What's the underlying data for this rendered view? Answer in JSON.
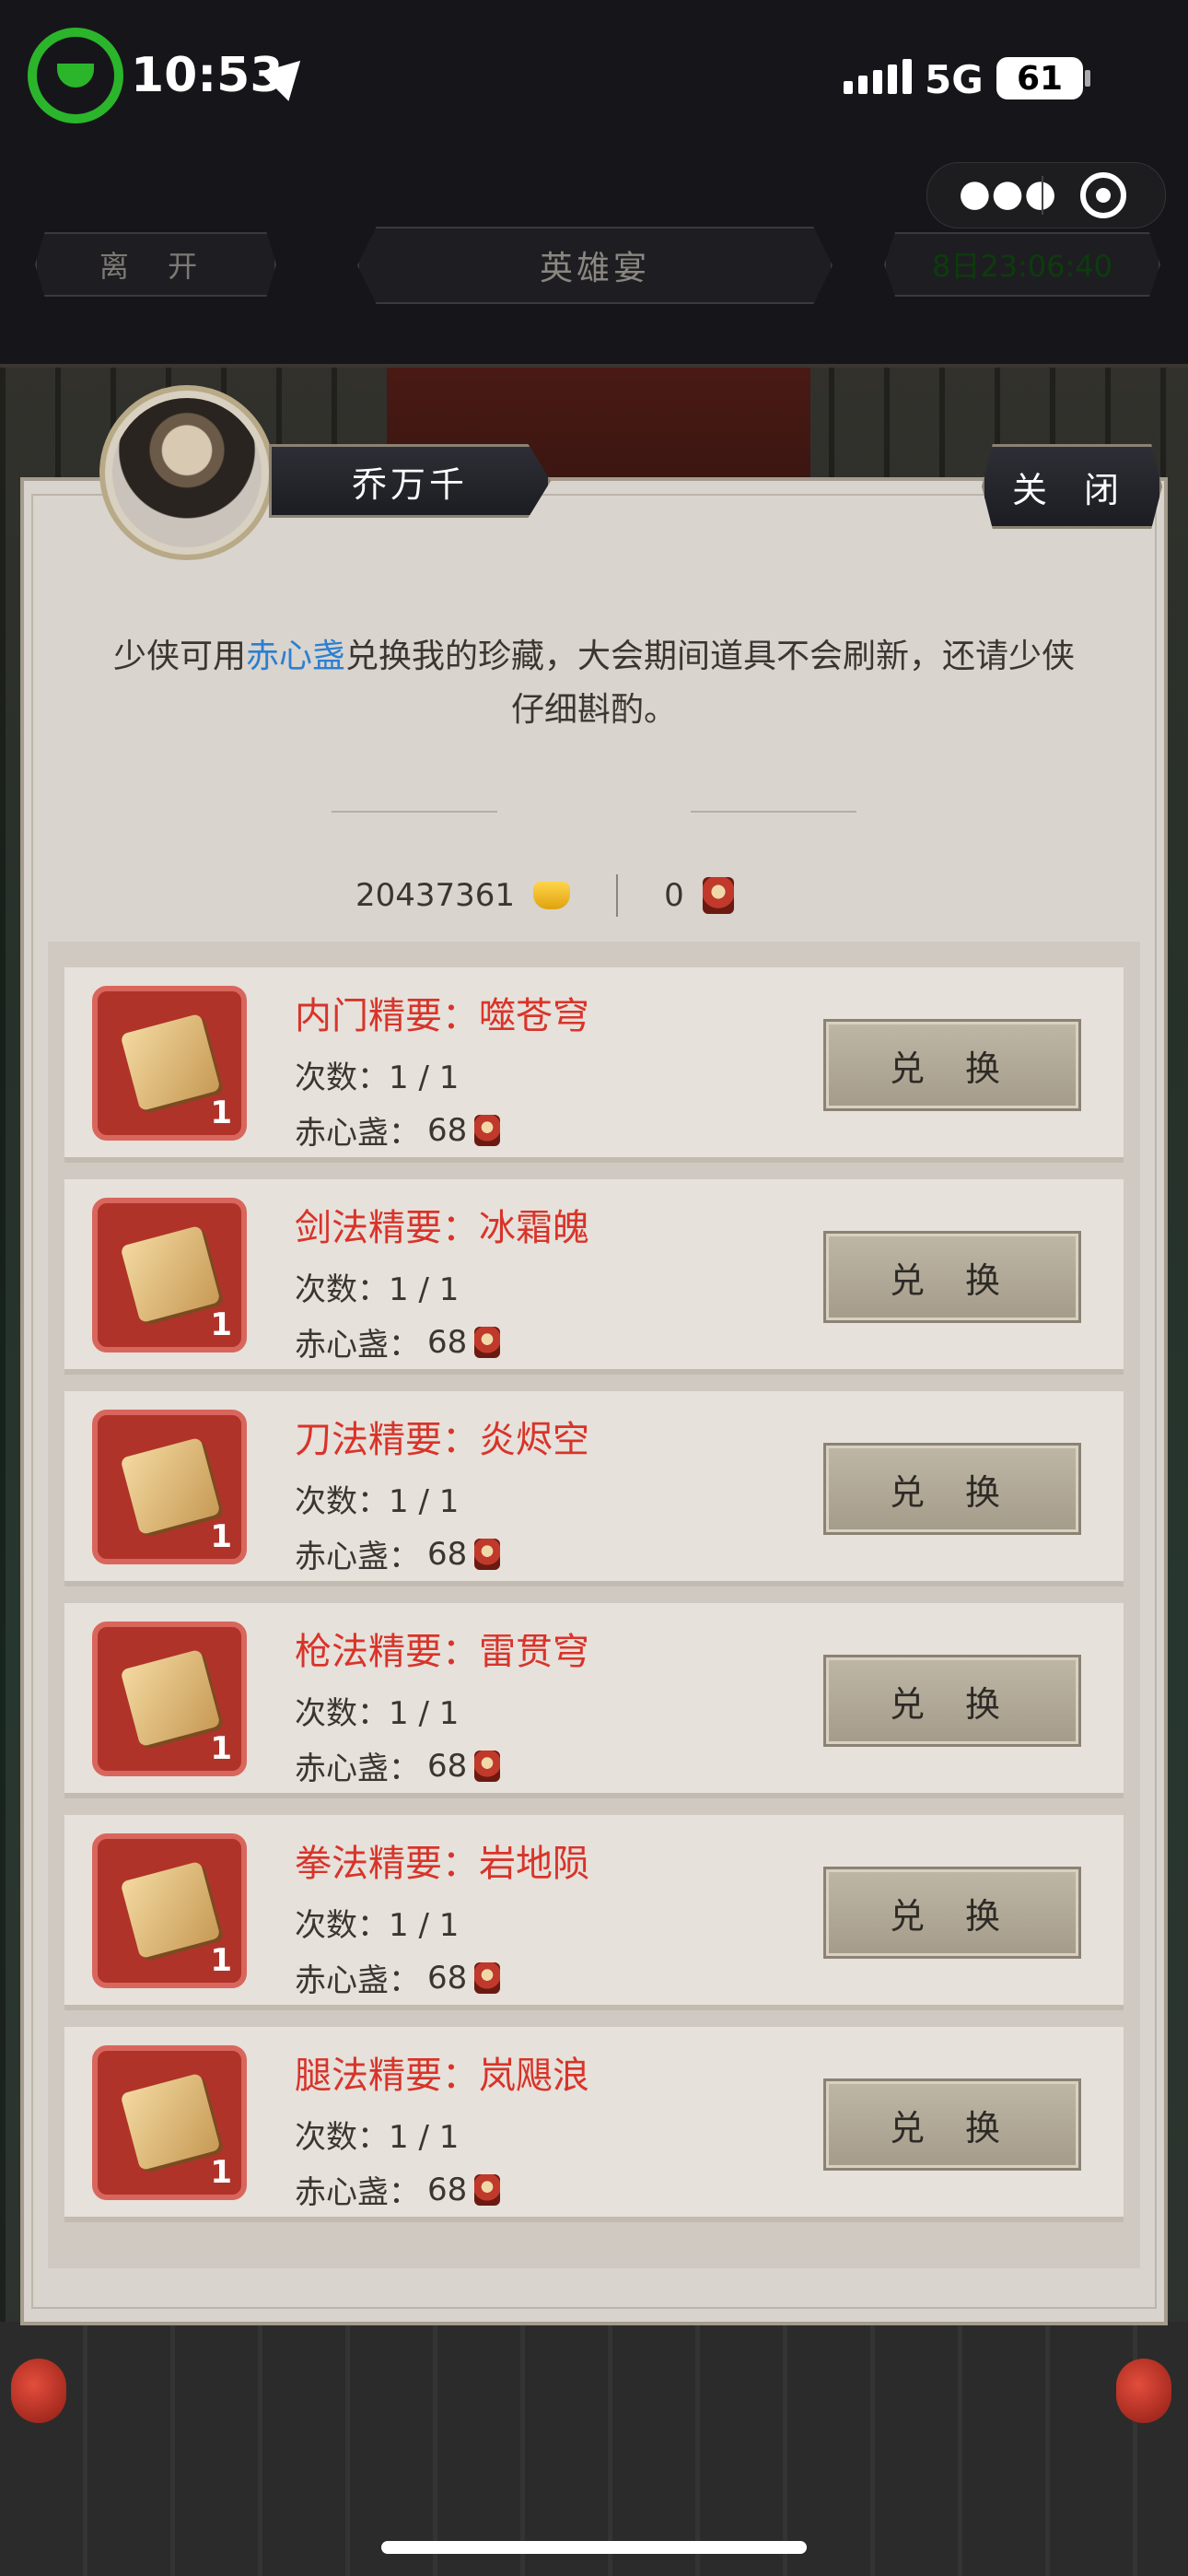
{
  "status_bar": {
    "time": "10:53",
    "network": "5G",
    "battery": "61"
  },
  "top_bar": {
    "leave_label": "离 开",
    "title": "英雄宴",
    "timer": "8日23:06:40"
  },
  "npc": {
    "name": "乔万千"
  },
  "close_label": "关 闭",
  "intro": {
    "part1": "少侠可用",
    "highlight": "赤心盏",
    "part2": "兑换我的珍藏，大会期间道具不会刷新，还请少侠仔细斟酌。"
  },
  "currency": {
    "gold": "20437361",
    "chixinzhan": "0"
  },
  "items": [
    {
      "name": "内门精要：噬苍穹",
      "times": "次数：1 / 1",
      "cost_label": "赤心盏：",
      "cost": "68",
      "count": "1",
      "button": "兑 换"
    },
    {
      "name": "剑法精要：冰霜魄",
      "times": "次数：1 / 1",
      "cost_label": "赤心盏：",
      "cost": "68",
      "count": "1",
      "button": "兑 换"
    },
    {
      "name": "刀法精要：炎烬空",
      "times": "次数：1 / 1",
      "cost_label": "赤心盏：",
      "cost": "68",
      "count": "1",
      "button": "兑 换"
    },
    {
      "name": "枪法精要：雷贯穹",
      "times": "次数：1 / 1",
      "cost_label": "赤心盏：",
      "cost": "68",
      "count": "1",
      "button": "兑 换"
    },
    {
      "name": "拳法精要：岩地陨",
      "times": "次数：1 / 1",
      "cost_label": "赤心盏：",
      "cost": "68",
      "count": "1",
      "button": "兑 换"
    },
    {
      "name": "腿法精要：岚飓浪",
      "times": "次数：1 / 1",
      "cost_label": "赤心盏：",
      "cost": "68",
      "count": "1",
      "button": "兑 换"
    }
  ]
}
